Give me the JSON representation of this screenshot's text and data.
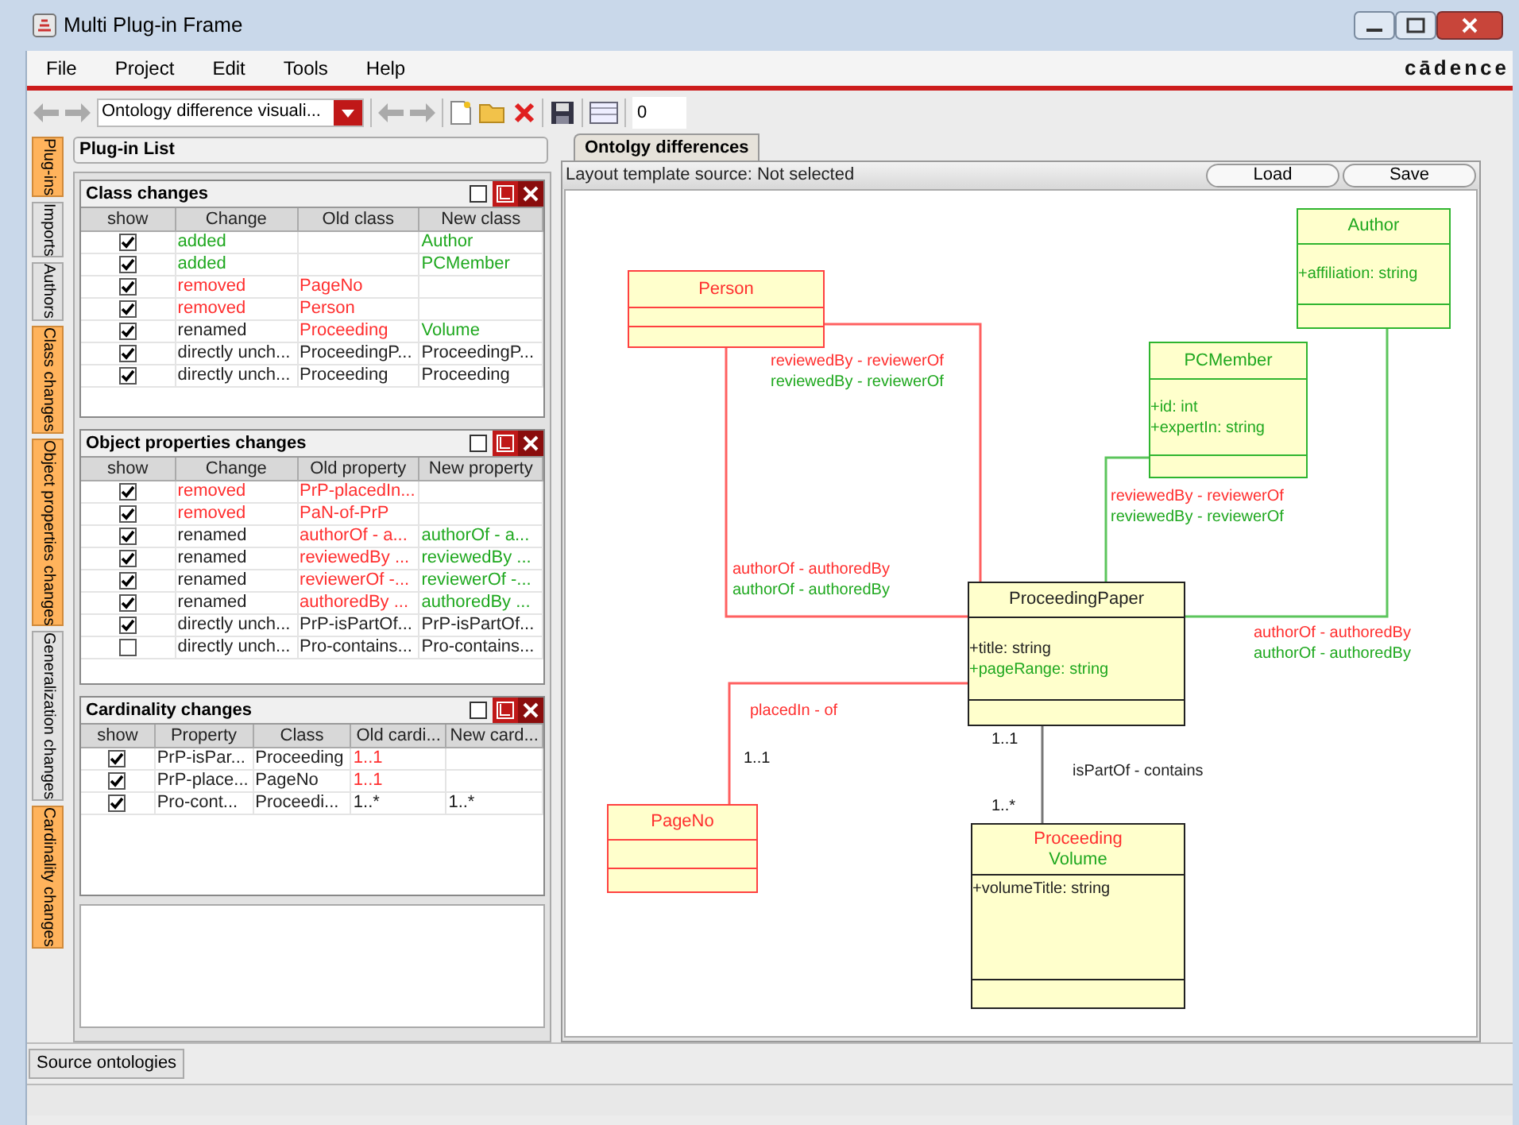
{
  "window": {
    "title": "Multi Plug-in Frame"
  },
  "menu": [
    "File",
    "Project",
    "Edit",
    "Tools",
    "Help"
  ],
  "logo": "cādence",
  "toolbar": {
    "plugin_combo": "Ontology difference visuali...",
    "number_field": "0"
  },
  "side_tabs": [
    {
      "label": "Plug-ins",
      "highlighted": true
    },
    {
      "label": "Imports",
      "highlighted": false
    },
    {
      "label": "Authors",
      "highlighted": false
    },
    {
      "label": "Class changes",
      "highlighted": true
    },
    {
      "label": "Object properties changes",
      "highlighted": true
    },
    {
      "label": "Generalization changes",
      "highlighted": false
    },
    {
      "label": "Cardinality changes",
      "highlighted": true
    }
  ],
  "left_panel": {
    "title": "Plug-in List",
    "frames": [
      {
        "title": "Class changes",
        "columns": [
          "show",
          "Change",
          "Old class",
          "New class"
        ],
        "rows": [
          {
            "cells": [
              {
                "checked": true
              },
              {
                "text": "added",
                "color": "#1fa81f"
              },
              {
                "text": ""
              },
              {
                "text": "Author",
                "color": "#1fa81f"
              }
            ]
          },
          {
            "cells": [
              {
                "checked": true
              },
              {
                "text": "added",
                "color": "#1fa81f"
              },
              {
                "text": ""
              },
              {
                "text": "PCMember",
                "color": "#1fa81f"
              }
            ]
          },
          {
            "cells": [
              {
                "checked": true
              },
              {
                "text": "removed",
                "color": "#ff2e2e"
              },
              {
                "text": "PageNo",
                "color": "#ff2e2e"
              },
              {
                "text": ""
              }
            ]
          },
          {
            "cells": [
              {
                "checked": true
              },
              {
                "text": "removed",
                "color": "#ff2e2e"
              },
              {
                "text": "Person",
                "color": "#ff2e2e"
              },
              {
                "text": ""
              }
            ]
          },
          {
            "cells": [
              {
                "checked": true
              },
              {
                "text": "renamed",
                "color": "#222222"
              },
              {
                "text": "Proceeding",
                "color": "#ff2e2e"
              },
              {
                "text": "Volume",
                "color": "#1fa81f"
              }
            ]
          },
          {
            "cells": [
              {
                "checked": true
              },
              {
                "text": "directly unch...",
                "color": "#222222"
              },
              {
                "text": "ProceedingP...",
                "color": "#222222"
              },
              {
                "text": "ProceedingP...",
                "color": "#222222"
              }
            ]
          },
          {
            "cells": [
              {
                "checked": true
              },
              {
                "text": "directly unch...",
                "color": "#222222"
              },
              {
                "text": "Proceeding",
                "color": "#222222"
              },
              {
                "text": "Proceeding",
                "color": "#222222"
              }
            ]
          }
        ]
      },
      {
        "title": "Object properties changes",
        "columns": [
          "show",
          "Change",
          "Old property",
          "New property"
        ],
        "rows": [
          {
            "cells": [
              {
                "checked": true
              },
              {
                "text": "removed",
                "color": "#ff2e2e"
              },
              {
                "text": "PrP-placedIn...",
                "color": "#ff2e2e"
              },
              {
                "text": ""
              }
            ]
          },
          {
            "cells": [
              {
                "checked": true
              },
              {
                "text": "removed",
                "color": "#ff2e2e"
              },
              {
                "text": "PaN-of-PrP",
                "color": "#ff2e2e"
              },
              {
                "text": ""
              }
            ]
          },
          {
            "cells": [
              {
                "checked": true
              },
              {
                "text": "renamed",
                "color": "#222222"
              },
              {
                "text": "authorOf - a...",
                "color": "#ff2e2e"
              },
              {
                "text": "authorOf - a...",
                "color": "#1fa81f"
              }
            ]
          },
          {
            "cells": [
              {
                "checked": true
              },
              {
                "text": "renamed",
                "color": "#222222"
              },
              {
                "text": "reviewedBy ...",
                "color": "#ff2e2e"
              },
              {
                "text": "reviewedBy ...",
                "color": "#1fa81f"
              }
            ]
          },
          {
            "cells": [
              {
                "checked": true
              },
              {
                "text": "renamed",
                "color": "#222222"
              },
              {
                "text": "reviewerOf -...",
                "color": "#ff2e2e"
              },
              {
                "text": "reviewerOf -...",
                "color": "#1fa81f"
              }
            ]
          },
          {
            "cells": [
              {
                "checked": true
              },
              {
                "text": "renamed",
                "color": "#222222"
              },
              {
                "text": "authoredBy ...",
                "color": "#ff2e2e"
              },
              {
                "text": "authoredBy ...",
                "color": "#1fa81f"
              }
            ]
          },
          {
            "cells": [
              {
                "checked": true
              },
              {
                "text": "directly unch...",
                "color": "#222222"
              },
              {
                "text": "PrP-isPartOf...",
                "color": "#222222"
              },
              {
                "text": "PrP-isPartOf...",
                "color": "#222222"
              }
            ]
          },
          {
            "cells": [
              {
                "checked": false
              },
              {
                "text": "directly unch...",
                "color": "#222222"
              },
              {
                "text": "Pro-contains...",
                "color": "#222222"
              },
              {
                "text": "Pro-contains...",
                "color": "#222222"
              }
            ]
          }
        ]
      },
      {
        "title": "Cardinality changes",
        "columns": [
          "show",
          "Property",
          "Class",
          "Old cardi...",
          "New card..."
        ],
        "rows": [
          {
            "cells": [
              {
                "checked": true
              },
              {
                "text": "PrP-isPar...",
                "color": "#222222"
              },
              {
                "text": "Proceeding",
                "color": "#222222"
              },
              {
                "text": "1..1",
                "color": "#ff2e2e"
              },
              {
                "text": ""
              }
            ]
          },
          {
            "cells": [
              {
                "checked": true
              },
              {
                "text": "PrP-place...",
                "color": "#222222"
              },
              {
                "text": "PageNo",
                "color": "#222222"
              },
              {
                "text": "1..1",
                "color": "#ff2e2e"
              },
              {
                "text": ""
              }
            ]
          },
          {
            "cells": [
              {
                "checked": true
              },
              {
                "text": "Pro-cont...",
                "color": "#222222"
              },
              {
                "text": "Proceedi...",
                "color": "#222222"
              },
              {
                "text": "1..*",
                "color": "#222222"
              },
              {
                "text": "1..*",
                "color": "#222222"
              }
            ]
          }
        ]
      }
    ]
  },
  "diagram_tab": {
    "label": "Ontolgy differences",
    "selected": true
  },
  "layout_source": "Layout template source: Not selected",
  "buttons": [
    "Load",
    "Save"
  ],
  "diagram": {
    "classes": [
      {
        "names": [
          {
            "text": "Person",
            "color": "#ff2e2e"
          }
        ],
        "color": "#ff4040"
      },
      {
        "names": [
          {
            "text": "Author",
            "color": "#1fa81f"
          }
        ],
        "color": "#2fb52f",
        "attributes": [
          {
            "text": "+affiliation: string",
            "color": "#1fa81f"
          }
        ]
      },
      {
        "names": [
          {
            "text": "PCMember",
            "color": "#1fa81f"
          }
        ],
        "color": "#2fb52f",
        "attributes": [
          {
            "text": "+id: int",
            "color": "#1fa81f"
          },
          {
            "text": "+expertIn: string",
            "color": "#1fa81f"
          }
        ]
      },
      {
        "names": [
          {
            "text": "ProceedingPaper",
            "color": "#222222"
          }
        ],
        "color": "#222222",
        "attributes": [
          {
            "text": "+title: string",
            "color": "#222222"
          },
          {
            "text": "+pageRange: string",
            "color": "#1fa81f"
          }
        ]
      },
      {
        "names": [
          {
            "text": "PageNo",
            "color": "#ff2e2e"
          }
        ],
        "color": "#ff4040"
      },
      {
        "names": [
          {
            "text": "Proceeding",
            "color": "#ff2e2e"
          },
          {
            "text": "Volume",
            "color": "#1fa81f"
          }
        ],
        "color": "#222222",
        "attributes": [
          {
            "text": "+volumeTitle: string",
            "color": "#222222"
          }
        ]
      }
    ],
    "edges": [
      {
        "color": "#ff6060",
        "labels": [
          {
            "text": "reviewedBy - reviewerOf",
            "color": "#ff2e2e"
          },
          {
            "text": "reviewedBy - reviewerOf",
            "color": "#1fa81f"
          }
        ]
      },
      {
        "color": "#ff6060",
        "labels": [
          {
            "text": "authorOf - authoredBy",
            "color": "#ff2e2e"
          },
          {
            "text": "authorOf - authoredBy",
            "color": "#1fa81f"
          }
        ]
      },
      {
        "color": "#5cc55c",
        "labels": [
          {
            "text": "reviewedBy - reviewerOf",
            "color": "#ff2e2e"
          },
          {
            "text": "reviewedBy - reviewerOf",
            "color": "#1fa81f"
          }
        ]
      },
      {
        "color": "#5cc55c",
        "labels": [
          {
            "text": "authorOf - authoredBy",
            "color": "#ff2e2e"
          },
          {
            "text": "authorOf - authoredBy",
            "color": "#1fa81f"
          }
        ]
      },
      {
        "color": "#ff6060",
        "labels": [
          {
            "text": "placedIn - of",
            "color": "#ff2e2e"
          }
        ],
        "multiplicities": [
          "1..1"
        ]
      },
      {
        "color": "#777777",
        "labels": [
          {
            "text": "isPartOf - contains",
            "color": "#222222"
          }
        ],
        "multiplicities": [
          "1..1",
          "1..*"
        ]
      }
    ]
  },
  "bottom_button": "Source ontologies"
}
